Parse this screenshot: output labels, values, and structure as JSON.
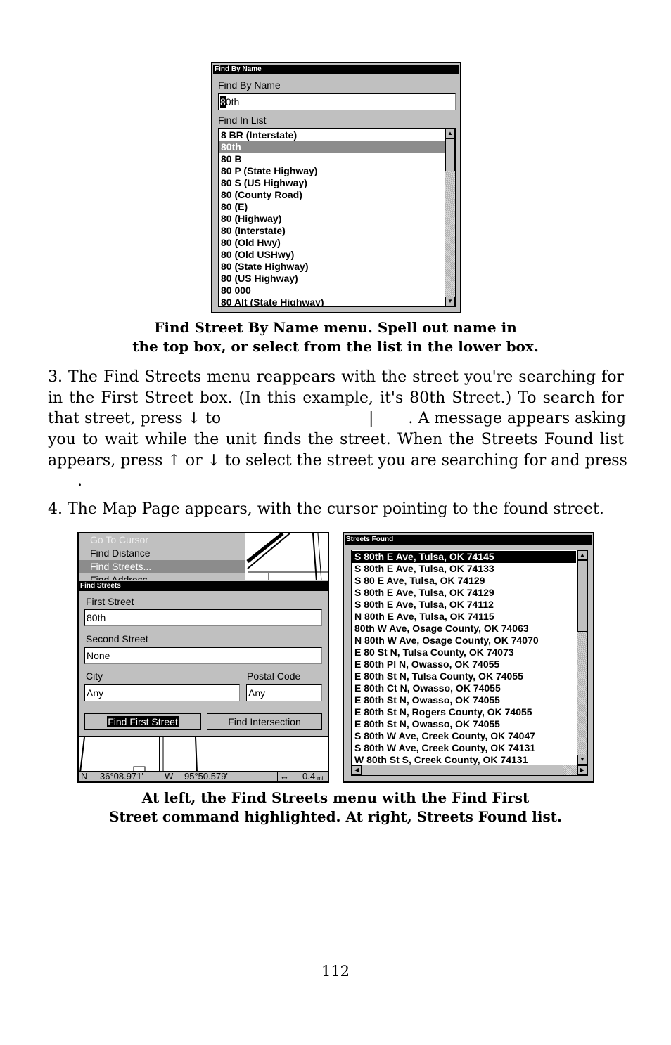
{
  "find_by_name": {
    "title_bar": "Find By Name",
    "name_label": "Find By Name",
    "cursor_char": "8",
    "name_rest": "0th",
    "list_label": "Find In List",
    "items": [
      "8 BR (Interstate)",
      "80th",
      "80  B",
      "80  P (State Highway)",
      "80  S (US Highway)",
      "80 (County Road)",
      "80 (E)",
      "80 (Highway)",
      "80 (Interstate)",
      "80 (Old Hwy)",
      "80 (Old USHwy)",
      "80 (State Highway)",
      "80 (US Highway)",
      "80 000",
      "80 Alt (State Highway)"
    ],
    "selected_index": 1
  },
  "caption_top": [
    "Find Street By Name menu. Spell out name in",
    "the top box, or select from the list in the lower box."
  ],
  "paragraph3": [
    "3. The Find Streets menu reappears with the street you're searching for",
    "in the First Street box. (In this example, it's 80th Street.) To search for",
    "that street, press ↓ to                              |       . A message appears asking",
    "you to wait while the unit finds the street. When the Streets Found list",
    "appears, press ↑ or ↓ to select the street you are searching for and press",
    "      ."
  ],
  "paragraph4": "4. The Map Page appears, with the cursor pointing to the found street.",
  "find_streets": {
    "menu_items": [
      "Go To Cursor",
      "Find Distance",
      "Find Streets...",
      "Find Address"
    ],
    "title_bar": "Find Streets",
    "first_street_label": "First Street",
    "first_street_value": "80th",
    "second_street_label": "Second Street",
    "second_street_value": "None",
    "city_label": "City",
    "city_value": "Any",
    "postal_label": "Postal Code",
    "postal_value": "Any",
    "find_first_button": "Find First Street",
    "find_intersection_button": "Find Intersection",
    "status": {
      "lat_hemi": "N",
      "lat": "36°08.971'",
      "lon_hemi": "W",
      "lon": "95°50.579'",
      "scale": "0.4",
      "scale_unit": "mi"
    }
  },
  "streets_found": {
    "title_bar": "Streets Found",
    "items": [
      "S 80th E Ave, Tulsa, OK 74145",
      "S 80th E Ave, Tulsa, OK 74133",
      "S 80 E Ave, Tulsa, OK 74129",
      "S 80th E Ave, Tulsa, OK 74129",
      "S 80th E Ave, Tulsa, OK 74112",
      "N 80th E Ave, Tulsa, OK 74115",
      "80th W Ave, Osage County, OK 74063",
      "N 80th W Ave, Osage County, OK 74070",
      "E 80 St N, Tulsa County, OK 74073",
      "E 80th Pl N, Owasso, OK 74055",
      "E 80th St N, Tulsa County, OK 74055",
      "E 80th Ct N, Owasso, OK 74055",
      "E 80th St N, Owasso, OK 74055",
      "E 80th St N, Rogers County, OK 74055",
      "E 80th St N, Owasso, OK 74055",
      "S 80th W Ave, Creek County, OK 74047",
      "S 80th W Ave, Creek County, OK 74131",
      "W 80th St S, Creek County, OK 74131"
    ],
    "selected_index": 0
  },
  "caption_bottom": [
    "At left, the Find Streets menu with the Find First",
    "Street command highlighted. At right, Streets Found list."
  ],
  "page_number": "112"
}
